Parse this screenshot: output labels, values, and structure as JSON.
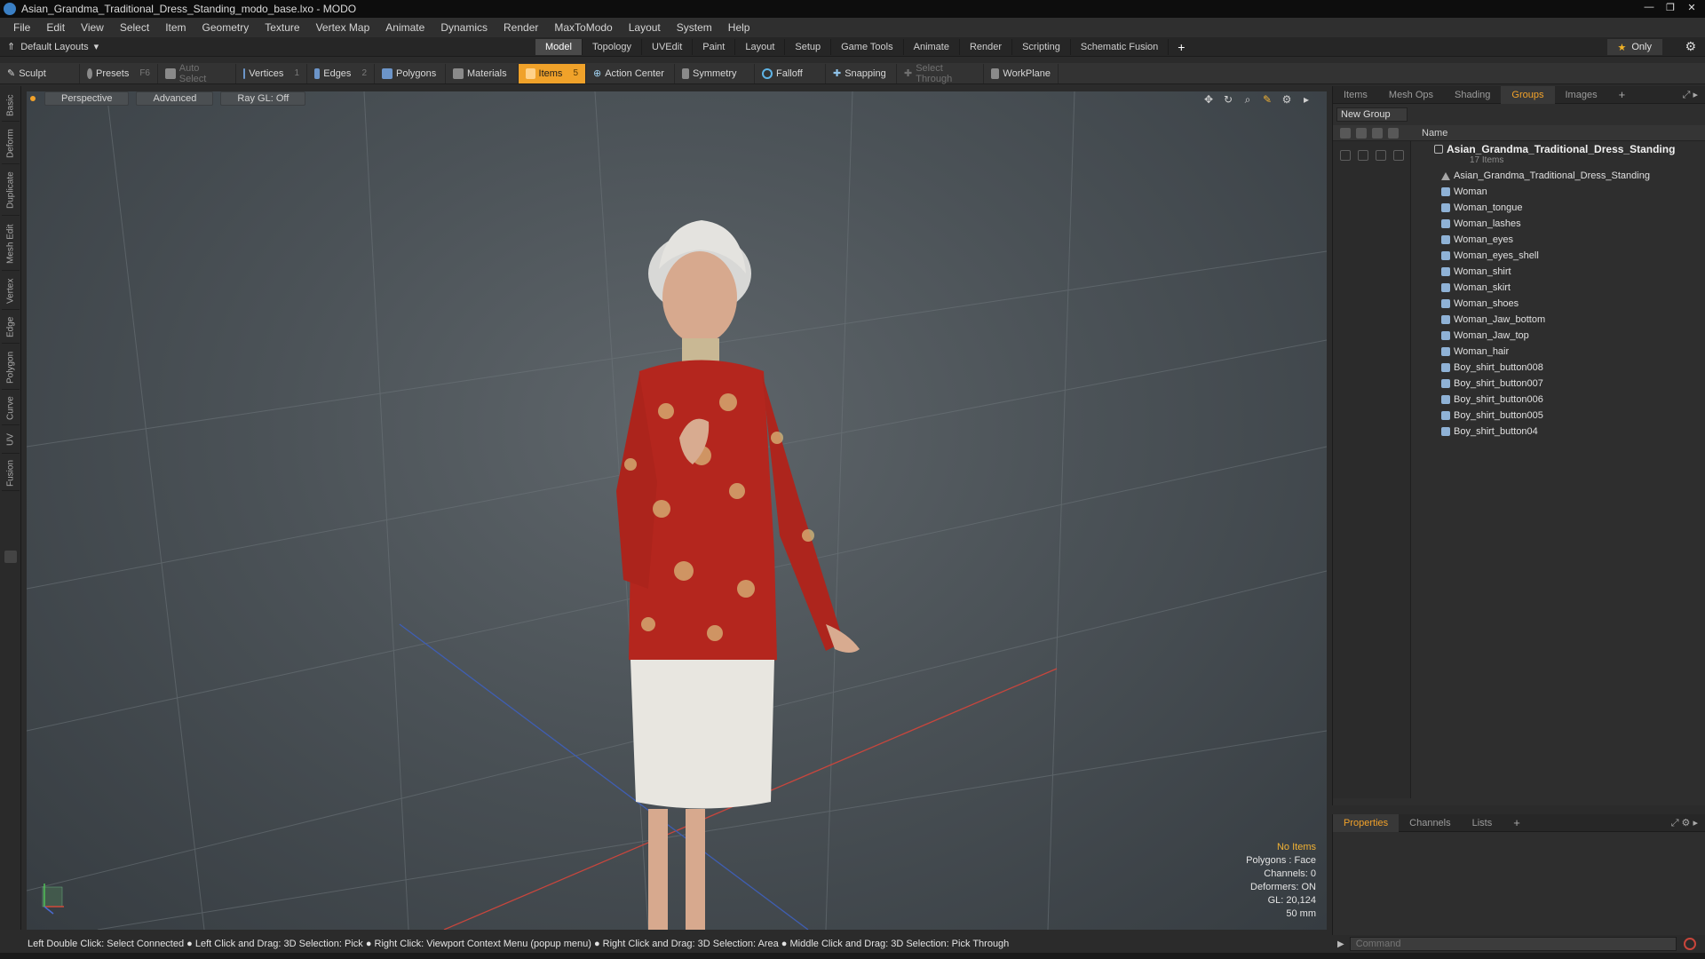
{
  "window": {
    "title": "Asian_Grandma_Traditional_Dress_Standing_modo_base.lxo - MODO",
    "controls": [
      "—",
      "❐",
      "✕"
    ]
  },
  "menu": [
    "File",
    "Edit",
    "View",
    "Select",
    "Item",
    "Geometry",
    "Texture",
    "Vertex Map",
    "Animate",
    "Dynamics",
    "Render",
    "MaxToModo",
    "Layout",
    "System",
    "Help"
  ],
  "layoutbar": {
    "layout_picker": "Default Layouts",
    "tabs": [
      "Model",
      "Topology",
      "UVEdit",
      "Paint",
      "Layout",
      "Setup",
      "Game Tools",
      "Animate",
      "Render",
      "Scripting",
      "Schematic Fusion"
    ],
    "active_tab": "Model",
    "plus": "+",
    "only_label": "Only"
  },
  "toolbar": {
    "sculpt": "Sculpt",
    "presets": "Presets",
    "presets_key": "F6",
    "auto_select": "Auto Select",
    "vertices": "Vertices",
    "vertices_key": "1",
    "edges": "Edges",
    "edges_key": "2",
    "polygons": "Polygons",
    "materials": "Materials",
    "items": "Items",
    "items_key": "5",
    "action_center": "Action Center",
    "symmetry": "Symmetry",
    "falloff": "Falloff",
    "snapping": "Snapping",
    "select_through": "Select Through",
    "workplane": "WorkPlane"
  },
  "left_tabs": [
    "Basic",
    "Deform",
    "Duplicate",
    "Mesh Edit",
    "Vertex",
    "Edge",
    "Polygon",
    "Curve",
    "UV",
    "Fusion"
  ],
  "viewport": {
    "view_mode": "Perspective",
    "shading": "Advanced",
    "raygl": "Ray GL: Off",
    "stats": {
      "selection": "No Items",
      "polygons": "Polygons : Face",
      "channels": "Channels: 0",
      "deformers": "Deformers: ON",
      "gl": "GL: 20,124",
      "focal": "50 mm"
    }
  },
  "statusbar": "Left Double Click: Select Connected ● Left Click and Drag: 3D Selection: Pick ● Right Click: Viewport Context Menu (popup menu) ● Right Click and Drag: 3D Selection: Area ● Middle Click and Drag: 3D Selection: Pick Through",
  "right_panel": {
    "tabs": [
      "Items",
      "Mesh Ops",
      "Shading",
      "Groups",
      "Images"
    ],
    "active_tab": "Groups",
    "new_group": "New Group",
    "name_header": "Name",
    "group": {
      "name": "Asian_Grandma_Traditional_Dress_Standing",
      "count": "17 Items"
    },
    "items": [
      "Asian_Grandma_Traditional_Dress_Standing",
      "Woman",
      "Woman_tongue",
      "Woman_lashes",
      "Woman_eyes",
      "Woman_eyes_shell",
      "Woman_shirt",
      "Woman_skirt",
      "Woman_shoes",
      "Woman_Jaw_bottom",
      "Woman_Jaw_top",
      "Woman_hair",
      "Boy_shirt_button008",
      "Boy_shirt_button007",
      "Boy_shirt_button006",
      "Boy_shirt_button005",
      "Boy_shirt_button04"
    ]
  },
  "props_panel": {
    "tabs": [
      "Properties",
      "Channels",
      "Lists"
    ],
    "active_tab": "Properties"
  },
  "command": {
    "placeholder": "Command"
  },
  "colors": {
    "accent": "#f0a22a",
    "viewport_bg": "#4b5257",
    "dress_red": "#b4261e",
    "skirt_white": "#e8e6e0",
    "shoes_red": "#c0121a"
  }
}
